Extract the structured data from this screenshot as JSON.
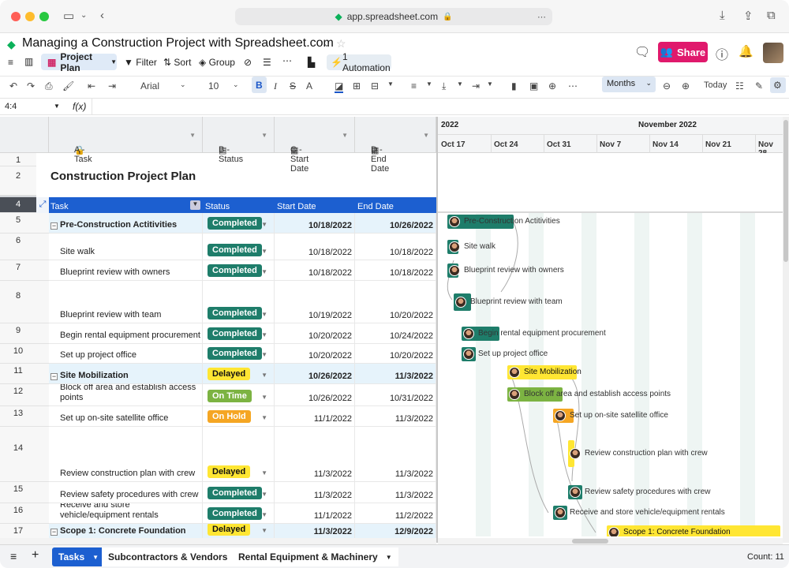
{
  "browser": {
    "url": "app.spreadsheet.com"
  },
  "app": {
    "title": "Managing a Construction Project with Spreadsheet.com",
    "share_label": "Share"
  },
  "toolbar": {
    "view_label": "Project Plan",
    "filter_label": "Filter",
    "sort_label": "Sort",
    "group_label": "Group",
    "automation_label": "1 Automation"
  },
  "format": {
    "font": "Arial",
    "font_size": "10",
    "months_label": "Months",
    "today_label": "Today"
  },
  "formula": {
    "cell_ref": "4:4",
    "fx": "f(x)"
  },
  "columns": [
    {
      "label": "A - Task"
    },
    {
      "label": "B - Status"
    },
    {
      "label": "C - Start Date"
    },
    {
      "label": "D - End Date"
    }
  ],
  "sheet_title": "Construction Project Plan",
  "header_row": {
    "task": "Task",
    "status": "Status",
    "start": "Start Date",
    "end": "End Date"
  },
  "rows": [
    {
      "num": "5",
      "task": "Pre-Construction Actitivities",
      "status": "Completed",
      "start": "10/18/2022",
      "end": "10/26/2022"
    },
    {
      "num": "6",
      "task": "Site walk",
      "status": "Completed",
      "start": "10/18/2022",
      "end": "10/18/2022"
    },
    {
      "num": "7",
      "task": "Blueprint review with owners",
      "status": "Completed",
      "start": "10/18/2022",
      "end": "10/18/2022"
    },
    {
      "num": "8",
      "task": "Blueprint review with team",
      "status": "Completed",
      "start": "10/19/2022",
      "end": "10/20/2022"
    },
    {
      "num": "9",
      "task": "Begin rental equipment procurement",
      "status": "Completed",
      "start": "10/20/2022",
      "end": "10/24/2022"
    },
    {
      "num": "10",
      "task": "Set up project office",
      "status": "Completed",
      "start": "10/20/2022",
      "end": "10/20/2022"
    },
    {
      "num": "11",
      "task": "Site Mobilization",
      "status": "Delayed",
      "start": "10/26/2022",
      "end": "11/3/2022"
    },
    {
      "num": "12",
      "task": "Block off area and establish access points",
      "status": "On Time",
      "start": "10/26/2022",
      "end": "10/31/2022"
    },
    {
      "num": "13",
      "task": "Set up on-site satellite office",
      "status": "On Hold",
      "start": "11/1/2022",
      "end": "11/3/2022"
    },
    {
      "num": "14",
      "task": "Review construction plan with crew",
      "status": "Delayed",
      "start": "11/3/2022",
      "end": "11/3/2022"
    },
    {
      "num": "15",
      "task": "Review safety procedures with crew",
      "status": "Completed",
      "start": "11/3/2022",
      "end": "11/3/2022"
    },
    {
      "num": "16",
      "task": "Receive and store vehicle/equipment rentals",
      "status": "Completed",
      "start": "11/1/2022",
      "end": "11/2/2022"
    },
    {
      "num": "17",
      "task": "Scope 1: Concrete Foundation",
      "status": "Delayed",
      "start": "11/3/2022",
      "end": "12/9/2022"
    }
  ],
  "status_colors": {
    "Completed": "#1e7d6a",
    "Delayed": "#ffe633",
    "On Time": "#7cb342",
    "On Hold": "#f5a623"
  },
  "gantt": {
    "year": "2022",
    "month": "November 2022",
    "weeks": [
      "Oct 17",
      "Oct 24",
      "Oct 31",
      "Nov 7",
      "Nov 14",
      "Nov 21",
      "Nov 28"
    ],
    "bars": [
      "Pre-Construction Actitivities",
      "Site walk",
      "Blueprint review with owners",
      "Blueprint review with team",
      "Begin rental equipment procurement",
      "Set up project office",
      "Site Mobilization",
      "Block off area and establish access points",
      "Set up on-site satellite office",
      "Review construction plan with crew",
      "Review safety procedures with crew",
      "Receive and store vehicle/equipment rentals",
      "Scope 1: Concrete Foundation"
    ]
  },
  "sheet_tabs": [
    {
      "label": "Tasks"
    },
    {
      "label": "Subcontractors & Vendors"
    },
    {
      "label": "Rental Equipment & Machinery"
    }
  ],
  "count_label": "Count: 11"
}
